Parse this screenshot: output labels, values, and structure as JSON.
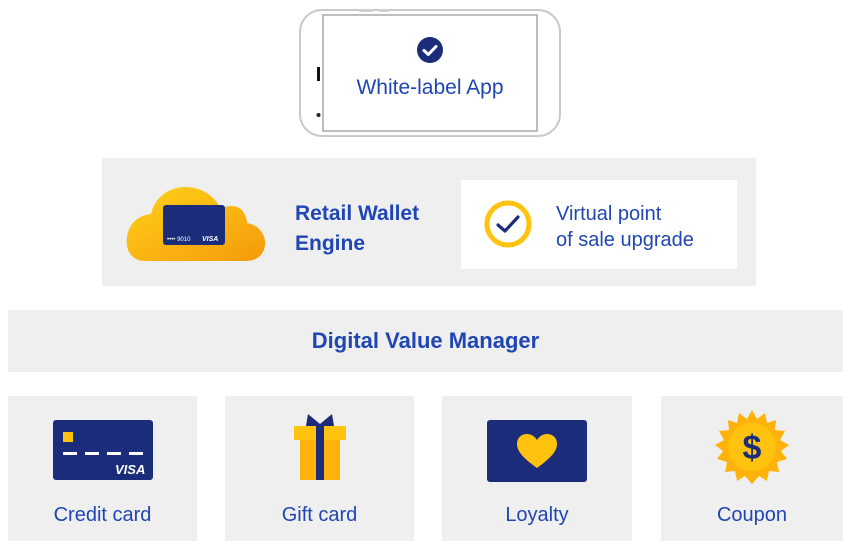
{
  "phone": {
    "label": "White-label App",
    "icon": "check-circle-icon"
  },
  "engine": {
    "title_line1": "Retail Wallet",
    "title_line2": "Engine",
    "card_number": "•••• 9010",
    "card_brand": "VISA",
    "upgrade_line1": "Virtual point",
    "upgrade_line2": "of sale upgrade"
  },
  "manager": {
    "label": "Digital Value Manager"
  },
  "tiles": [
    {
      "label": "Credit card",
      "icon": "credit-card-icon",
      "brand": "VISA"
    },
    {
      "label": "Gift card",
      "icon": "gift-icon"
    },
    {
      "label": "Loyalty",
      "icon": "heart-card-icon"
    },
    {
      "label": "Coupon",
      "icon": "dollar-badge-icon",
      "symbol": "$"
    }
  ],
  "colors": {
    "navy": "#1b2d7a",
    "blue_text": "#1f46b3",
    "amber": "#ffc20e",
    "orange": "#f7a20a",
    "panel_gray": "#efeff0"
  }
}
